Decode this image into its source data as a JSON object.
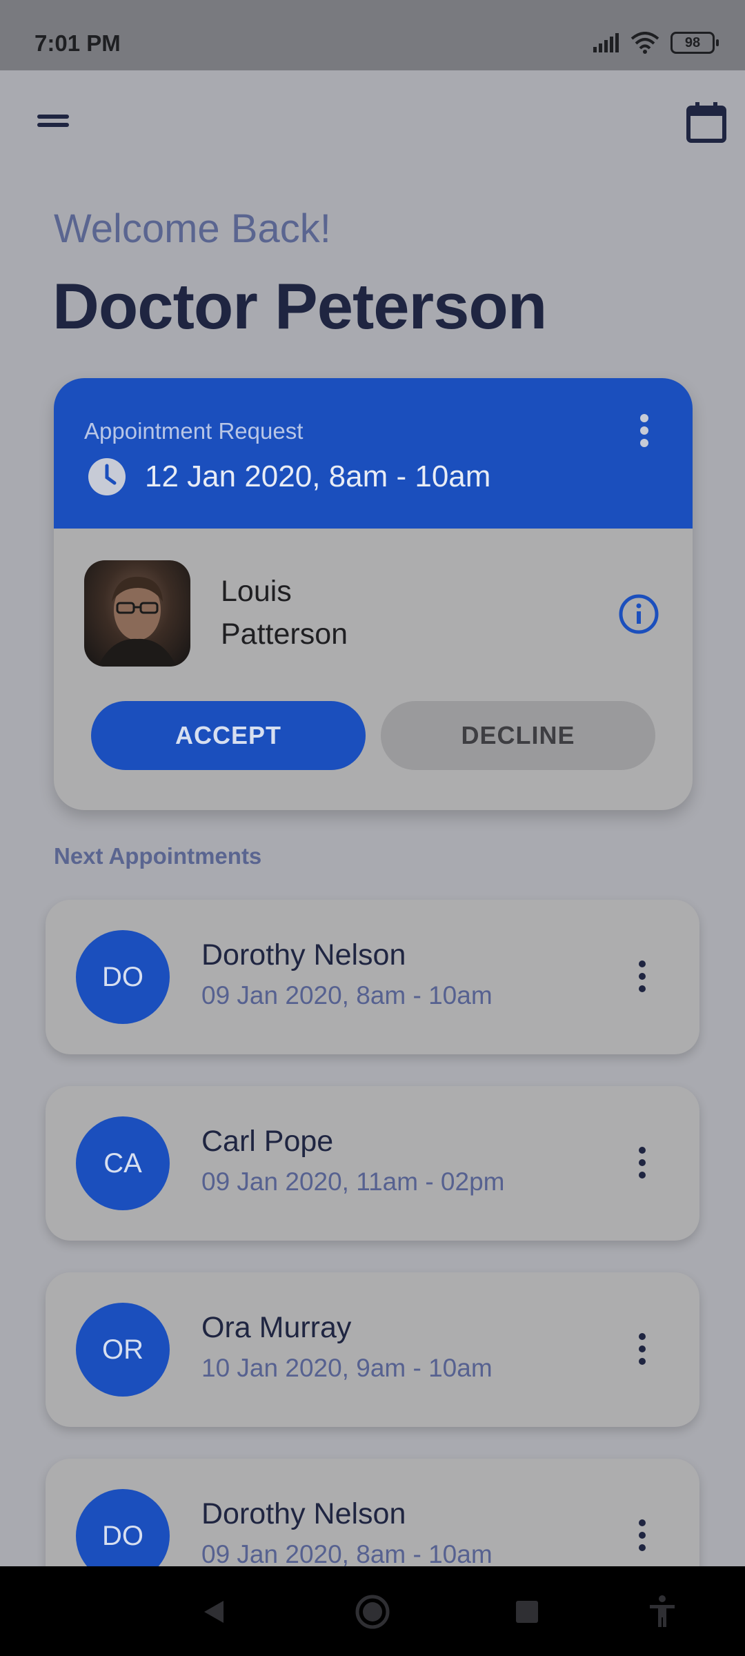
{
  "status_bar": {
    "time": "7:01 PM",
    "battery": "98"
  },
  "header": {
    "welcome": "Welcome Back!",
    "doctor_name": "Doctor Peterson"
  },
  "request": {
    "title": "Appointment Request",
    "time": "12 Jan 2020, 8am - 10am",
    "patient_first": "Louis",
    "patient_last": "Patterson",
    "accept_label": "ACCEPT",
    "decline_label": "DECLINE"
  },
  "next": {
    "title": "Next Appointments",
    "items": [
      {
        "initials": "DO",
        "name": "Dorothy Nelson",
        "time": "09 Jan 2020, 8am - 10am"
      },
      {
        "initials": "CA",
        "name": "Carl Pope",
        "time": "09 Jan 2020, 11am - 02pm"
      },
      {
        "initials": "OR",
        "name": "Ora Murray",
        "time": "10 Jan 2020, 9am - 10am"
      },
      {
        "initials": "DO",
        "name": "Dorothy Nelson",
        "time": "09 Jan 2020, 8am - 10am"
      }
    ]
  },
  "colors": {
    "primary": "#1b4fbd",
    "text_dark": "#1f2541",
    "text_muted": "#5a6590"
  }
}
